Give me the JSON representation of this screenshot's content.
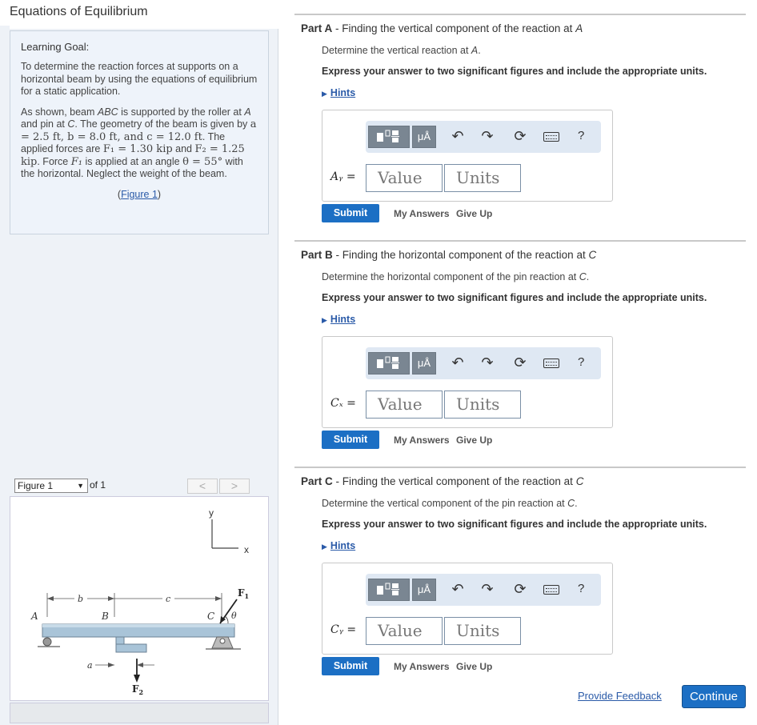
{
  "title": "Equations of Equilibrium",
  "goal": {
    "heading": "Learning Goal:",
    "p1": "To determine the reaction forces at supports on a horizontal beam by using the equations of equilibrium for a static application.",
    "p2_a": "As shown, beam ",
    "p2_abc": "ABC",
    "p2_b": " is supported by the roller at ",
    "p2_A": "A",
    "p2_c": " and pin at ",
    "p2_C": "C",
    "p2_d": ". The geometry of the beam is given by ",
    "p2_geom": "a = 2.5 ft, b = 8.0 ft, and c = 12.0 ft",
    "p2_e": ". The applied forces are ",
    "p2_F1": "F₁ = 1.30 kip",
    "p2_f": " and ",
    "p2_F2": "F₂ = 1.25 kip",
    "p2_g": ". Force ",
    "p2_F1b": "F₁",
    "p2_h": " is applied at an angle ",
    "p2_theta": "θ = 55°",
    "p2_i": " with the horizontal. Neglect the weight of the beam.",
    "figure_link_pre": "(",
    "figure_link": "Figure 1",
    "figure_link_post": ")"
  },
  "figure_nav": {
    "select": "Figure 1",
    "of": "of 1",
    "prev": "<",
    "next": ">"
  },
  "figure": {
    "y": "y",
    "x": "x",
    "A": "A",
    "B": "B",
    "C": "C",
    "a": "a",
    "b": "b",
    "c": "c",
    "F1": "F",
    "F1sub": "1",
    "F2": "F",
    "F2sub": "2",
    "theta": "θ"
  },
  "parts": [
    {
      "label": "Part A",
      "title_pre": " - Finding the vertical component of the reaction at ",
      "title_var": "A",
      "instruction_pre": "Determine the vertical reaction at ",
      "instruction_var": "A",
      "instruction_post": ".",
      "express": "Express your answer to two significant figures and include the appropriate units.",
      "hints": "Hints",
      "variable": "Aᵧ =",
      "value_placeholder": "Value",
      "units_placeholder": "Units",
      "submit": "Submit",
      "my_answers": "My Answers",
      "give_up": "Give Up"
    },
    {
      "label": "Part B",
      "title_pre": " - Finding the horizontal component of the reaction at ",
      "title_var": "C",
      "instruction_pre": "Determine the horizontal component of the pin reaction at ",
      "instruction_var": "C",
      "instruction_post": ".",
      "express": "Express your answer to two significant figures and include the appropriate units.",
      "hints": "Hints",
      "variable": "Cₓ =",
      "value_placeholder": "Value",
      "units_placeholder": "Units",
      "submit": "Submit",
      "my_answers": "My Answers",
      "give_up": "Give Up"
    },
    {
      "label": "Part C",
      "title_pre": " - Finding the vertical component of the reaction at ",
      "title_var": "C",
      "instruction_pre": "Determine the vertical component of the pin reaction at ",
      "instruction_var": "C",
      "instruction_post": ".",
      "express": "Express your answer to two significant figures and include the appropriate units.",
      "hints": "Hints",
      "variable": "Cᵧ =",
      "value_placeholder": "Value",
      "units_placeholder": "Units",
      "submit": "Submit",
      "my_answers": "My Answers",
      "give_up": "Give Up"
    }
  ],
  "toolbar": {
    "mu_label": "μÅ",
    "undo": "↶",
    "redo": "↷",
    "reset": "⟳",
    "help": "?",
    "icons": [
      "templates-icon",
      "units-icon",
      "undo-icon",
      "redo-icon",
      "reset-icon",
      "keyboard-icon",
      "help-icon"
    ]
  },
  "footer": {
    "feedback": "Provide Feedback",
    "continue": "Continue"
  },
  "colors": {
    "accent": "#1c6fc4",
    "link": "#2a5aa8",
    "toolbar_bg": "#dfe8f3",
    "left_bg": "#eef2f7"
  }
}
